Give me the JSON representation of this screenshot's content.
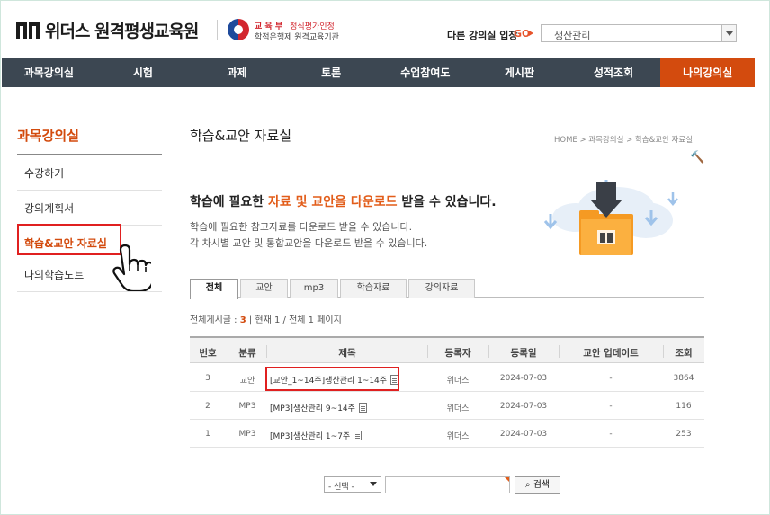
{
  "header": {
    "logo_text": "위더스 원격평생교육원",
    "moe_line1_a": "교 육 부",
    "moe_line1_b": "정식평가인정",
    "moe_line2": "학점은행제 원격교육기관",
    "other_course_label": "다른 강의실 입장",
    "go_label": "GO",
    "course_select_value": "생산관리"
  },
  "nav": {
    "items": [
      "과목강의실",
      "시험",
      "과제",
      "토론",
      "수업참여도",
      "게시판",
      "성적조회",
      "나의강의실"
    ],
    "active_index": 7
  },
  "sidebar": {
    "title": "과목강의실",
    "items": [
      "수강하기",
      "강의계획서",
      "학습&교안 자료실",
      "나의학습노트"
    ],
    "active_index": 2
  },
  "main": {
    "page_title": "학습&교안 자료실",
    "breadcrumb": "HOME > 과목강의실 > 학습&교안 자료실",
    "intro_head_a": "학습에 필요한 ",
    "intro_head_hl": "자료 및 교안을 다운로드",
    "intro_head_b": " 받을 수 있습니다.",
    "intro_line1": "학습에 필요한 참고자료를 다운로드 받을 수 있습니다.",
    "intro_line2": "각 차시별 교안 및 통합교안을 다운로드 받을 수 있습니다.",
    "tabs": [
      "전체",
      "교안",
      "mp3",
      "학습자료",
      "강의자료"
    ],
    "active_tab": 0,
    "board_info": {
      "label": "전체게시글 : ",
      "count": "3",
      "rest": " | 현재 1 / 전체 1 페이지"
    }
  },
  "table": {
    "headers": [
      "번호",
      "분류",
      "제목",
      "등록자",
      "등록일",
      "교안 업데이트",
      "조회"
    ],
    "rows": [
      {
        "no": "3",
        "cat": "교안",
        "title": "[교안_1~14주]생산관리 1~14주",
        "author": "위더스",
        "date": "2024-07-03",
        "update": "-",
        "views": "3864"
      },
      {
        "no": "2",
        "cat": "MP3",
        "title": "[MP3]생산관리 9~14주",
        "author": "위더스",
        "date": "2024-07-03",
        "update": "-",
        "views": "116"
      },
      {
        "no": "1",
        "cat": "MP3",
        "title": "[MP3]생산관리 1~7주",
        "author": "위더스",
        "date": "2024-07-03",
        "update": "-",
        "views": "253"
      }
    ]
  },
  "search": {
    "select_value": "- 선택 -",
    "button_label": "검색"
  },
  "colors": {
    "accent": "#d34b0e",
    "nav_bg": "#3c4752",
    "highlight_box": "#e02020"
  }
}
